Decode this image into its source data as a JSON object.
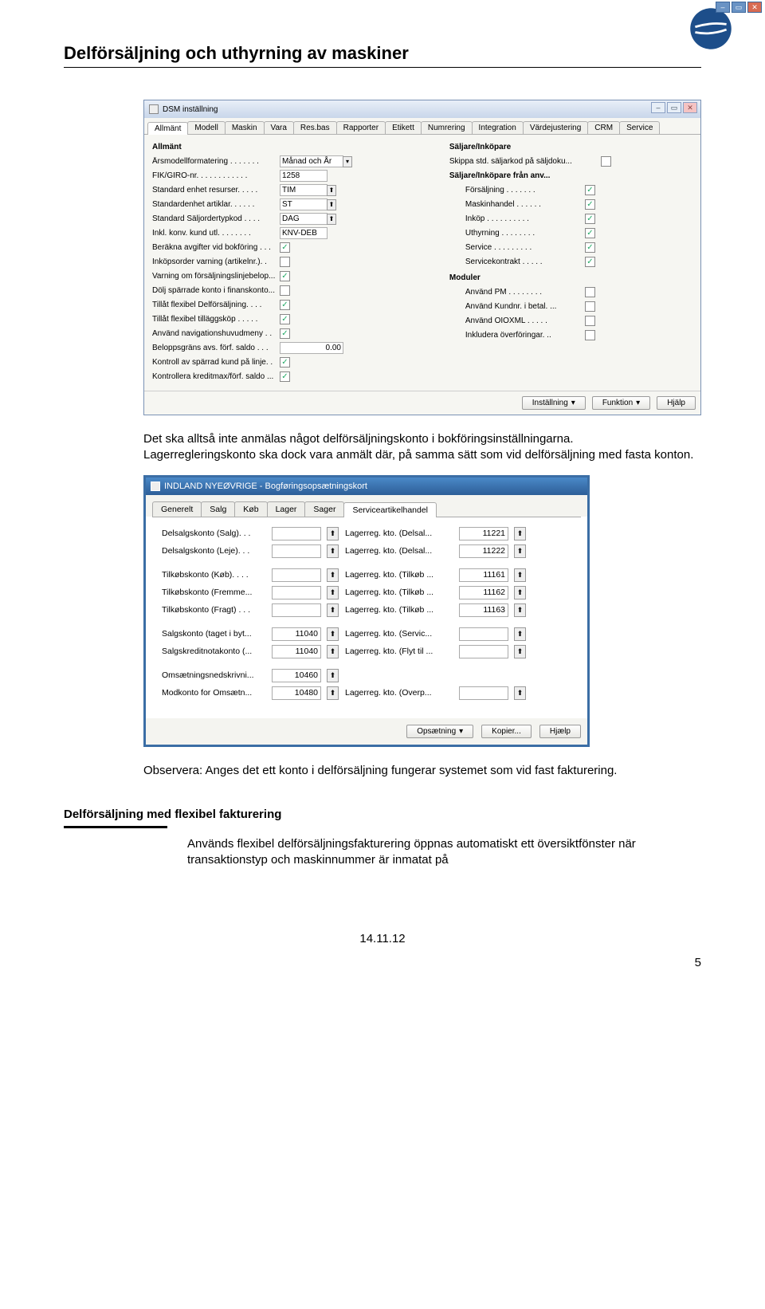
{
  "doc_title": "Delförsäljning och uthyrning av maskiner",
  "win1": {
    "title": "DSM inställning",
    "tabs": [
      "Allmänt",
      "Modell",
      "Maskin",
      "Vara",
      "Res.bas",
      "Rapporter",
      "Etikett",
      "Numrering",
      "Integration",
      "Värdejustering",
      "CRM",
      "Service"
    ],
    "group_left": "Allmänt",
    "left": [
      {
        "label": "Årsmodellformatering . . . . . . .",
        "value": "Månad och År",
        "ctl": "dd"
      },
      {
        "label": "FIK/GIRO-nr. . . . . . . . . . . .",
        "value": "1258",
        "ctl": "txt"
      },
      {
        "label": "Standard enhet resurser. . . . .",
        "value": "TIM",
        "ctl": "look"
      },
      {
        "label": "Standardenhet artiklar. . . . . .",
        "value": "ST",
        "ctl": "look"
      },
      {
        "label": "Standard Säljordertypkod . . . .",
        "value": "DAG",
        "ctl": "look"
      },
      {
        "label": "Inkl. konv. kund utl. . . . . . . .",
        "value": "KNV-DEB",
        "ctl": "txt"
      },
      {
        "label": "Beräkna avgifter vid bokföring . . .",
        "value": "1",
        "ctl": "cb"
      },
      {
        "label": "Inköpsorder varning (artikelnr.). .",
        "value": "",
        "ctl": "cb"
      },
      {
        "label": "Varning om försäljningslinjebelop...",
        "value": "1",
        "ctl": "cb"
      },
      {
        "label": "Dölj spärrade konto i finanskonto...",
        "value": "",
        "ctl": "cb"
      },
      {
        "label": "Tillåt flexibel Delförsäljning. . . .",
        "value": "1",
        "ctl": "cb"
      },
      {
        "label": "Tillåt flexibel tilläggsköp . . . . .",
        "value": "1",
        "ctl": "cb"
      },
      {
        "label": "Använd navigationshuvudmeny . .",
        "value": "1",
        "ctl": "cb"
      },
      {
        "label": "Beloppsgräns avs. förf. saldo . . .",
        "value": "0.00",
        "ctl": "num"
      },
      {
        "label": "Kontroll av spärrad kund på linje. .",
        "value": "1",
        "ctl": "cb"
      },
      {
        "label": "Kontrollera kreditmax/förf. saldo ...",
        "value": "1",
        "ctl": "cb"
      }
    ],
    "group_right1": "Säljare/Inköpare",
    "right1_label": "Skippa std. säljarkod på säljdoku...",
    "group_right2": "Säljare/Inköpare från anv...",
    "right2": [
      {
        "label": "Försäljning . . . . . . .",
        "value": "1"
      },
      {
        "label": "Maskinhandel . . . . . .",
        "value": "1"
      },
      {
        "label": "Inköp . . . . . . . . . .",
        "value": "1"
      },
      {
        "label": "Uthyrning . . . . . . . .",
        "value": "1"
      },
      {
        "label": "Service . . . . . . . . .",
        "value": "1"
      },
      {
        "label": "Servicekontrakt . . . . .",
        "value": "1"
      }
    ],
    "group_right3": "Moduler",
    "right3": [
      {
        "label": "Använd PM . . . . . . . .",
        "value": ""
      },
      {
        "label": "Använd Kundnr. i betal. ...",
        "value": ""
      },
      {
        "label": "Använd OIOXML . . . . .",
        "value": ""
      },
      {
        "label": "Inkludera överföringar. ..",
        "value": ""
      }
    ],
    "buttons": [
      "Inställning",
      "Funktion",
      "Hjälp"
    ]
  },
  "para1": "Det ska alltså inte anmälas något delförsäljningskonto i bokföringsinställningarna.",
  "para1b": "Lagerregleringskonto ska dock vara anmält där, på samma sätt som vid delförsäljning med fasta konton.",
  "win2": {
    "title": "INDLAND NYEØVRIGE - Bogføringsopsætningskort",
    "tabs": [
      "Generelt",
      "Salg",
      "Køb",
      "Lager",
      "Sager",
      "Serviceartikelhandel"
    ],
    "rows": [
      {
        "l1": "Delsalgskonto (Salg). . .",
        "v1": "",
        "l2": "Lagerreg. kto. (Delsal...",
        "v2": "11221"
      },
      {
        "l1": "Delsalgskonto (Leje). . .",
        "v1": "",
        "l2": "Lagerreg. kto. (Delsal...",
        "v2": "11222"
      },
      {
        "gap": true
      },
      {
        "l1": "Tilkøbskonto (Køb). . . .",
        "v1": "",
        "l2": "Lagerreg. kto. (Tilkøb ...",
        "v2": "11161"
      },
      {
        "l1": "Tilkøbskonto (Fremme...",
        "v1": "",
        "l2": "Lagerreg. kto. (Tilkøb ...",
        "v2": "11162"
      },
      {
        "l1": "Tilkøbskonto (Fragt) . . .",
        "v1": "",
        "l2": "Lagerreg. kto. (Tilkøb ...",
        "v2": "11163"
      },
      {
        "gap": true
      },
      {
        "l1": "Salgskonto (taget i byt...",
        "v1": "11040",
        "l2": "Lagerreg. kto. (Servic...",
        "v2": ""
      },
      {
        "l1": "Salgskreditnotakonto (...",
        "v1": "11040",
        "l2": "Lagerreg. kto. (Flyt til ...",
        "v2": ""
      },
      {
        "gap": true
      },
      {
        "l1": "Omsætningsnedskrivni...",
        "v1": "10460",
        "l2": "",
        "v2": ""
      },
      {
        "l1": "Modkonto for Omsætn...",
        "v1": "10480",
        "l2": "Lagerreg. kto. (Overp...",
        "v2": ""
      }
    ],
    "buttons": [
      "Opsætning",
      "Kopier...",
      "Hjælp"
    ]
  },
  "para2": "Observera: Anges det ett konto i delförsäljning fungerar systemet som vid fast fakturering.",
  "section_heading": "Delförsäljning med flexibel fakturering",
  "para3": "Används flexibel delförsäljningsfakturering öppnas automatiskt ett översiktfönster när transaktionstyp och maskinnummer är inmatat på",
  "footer_date": "14.11.12",
  "footer_page": "5"
}
